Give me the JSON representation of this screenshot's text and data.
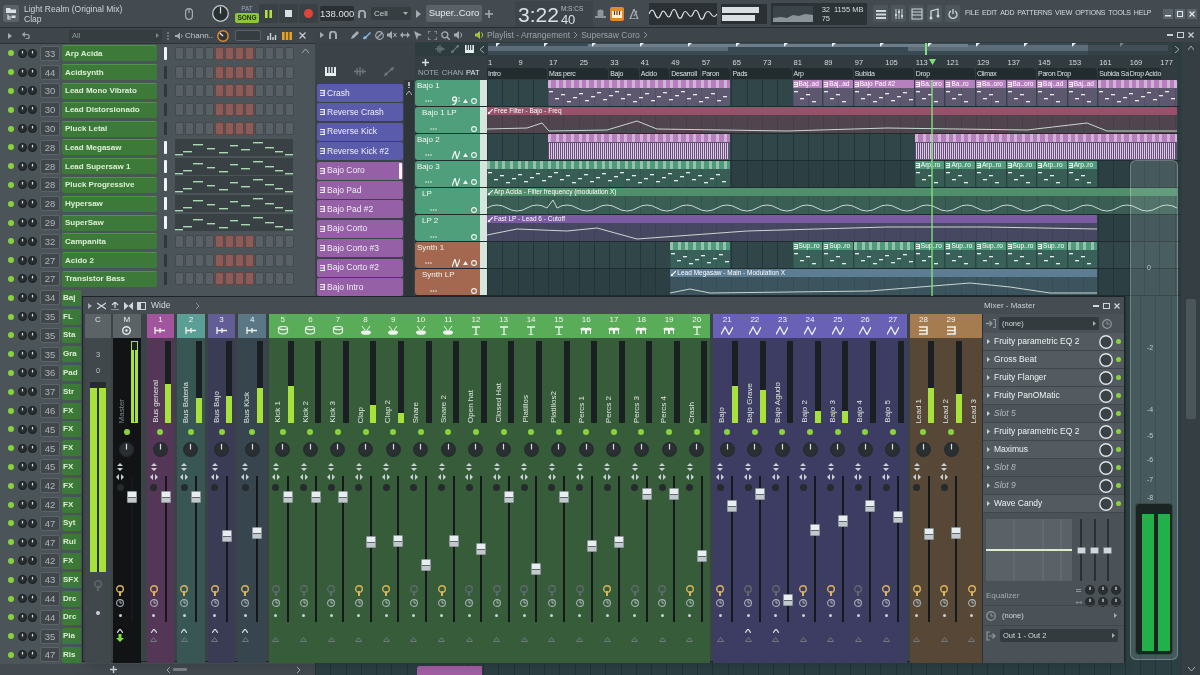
{
  "title_bar": {
    "song": "Light Realm (Original Mix)",
    "hint": "Clap"
  },
  "transport": {
    "modes": [
      {
        "label": "PAT",
        "selected": false
      },
      {
        "label": "SONG",
        "selected": true
      }
    ],
    "playing": true,
    "tempo": "138.000",
    "snap": "Cell",
    "pattern": "Super..Coro",
    "time": "3:22",
    "time_fraction": "40",
    "time_unit": "M:S:CS",
    "output_meter": {
      "level": 0.85
    },
    "cpu": "32",
    "memory": "1155 MB",
    "polyphony": "75"
  },
  "menu": [
    "FILE",
    "EDIT",
    "ADD",
    "PATTERNS",
    "VIEW",
    "OPTIONS",
    "TOOLS",
    "HELP"
  ],
  "channel_rack": {
    "filter": "All",
    "title": "Chann..",
    "channels": [
      {
        "kind": "steps",
        "number": "33",
        "name": "Arp Acida",
        "selected": true
      },
      {
        "kind": "steps",
        "number": "44",
        "name": "Acidsynth",
        "selected": false
      },
      {
        "kind": "steps",
        "number": "30",
        "name": "Lead Mono Vibrato",
        "selected": false
      },
      {
        "kind": "steps",
        "number": "30",
        "name": "Lead Distorsionado",
        "selected": false
      },
      {
        "kind": "steps",
        "number": "30",
        "name": "Pluck Letal",
        "selected": false
      },
      {
        "kind": "roll",
        "number": "28",
        "name": "Lead Megasaw",
        "selected": true
      },
      {
        "kind": "roll",
        "number": "28",
        "name": "Lead Supersaw 1",
        "selected": true
      },
      {
        "kind": "roll",
        "number": "28",
        "name": "Pluck Progressive",
        "selected": true
      },
      {
        "kind": "roll",
        "number": "28",
        "name": "Hypersaw",
        "selected": true
      },
      {
        "kind": "roll",
        "number": "29",
        "name": "SuperSaw",
        "selected": true
      },
      {
        "kind": "steps",
        "number": "32",
        "name": "Campanita",
        "selected": false
      },
      {
        "kind": "steps",
        "number": "27",
        "name": "Acido 2",
        "selected": false
      },
      {
        "kind": "steps",
        "number": "27",
        "name": "Transistor Bass",
        "selected": false
      },
      {
        "kind": "cut",
        "number": "34",
        "name": "Baj"
      },
      {
        "kind": "cut",
        "number": "35",
        "name": "FL"
      },
      {
        "kind": "cut",
        "number": "35",
        "name": "Sta"
      },
      {
        "kind": "cut",
        "number": "35",
        "name": "Gra"
      },
      {
        "kind": "cut",
        "number": "36",
        "name": "Pad"
      },
      {
        "kind": "cut",
        "number": "37",
        "name": "Str"
      },
      {
        "kind": "cut",
        "number": "46",
        "name": "FX"
      },
      {
        "kind": "cut",
        "number": "45",
        "name": "FX"
      },
      {
        "kind": "cut",
        "number": "45",
        "name": "FX"
      },
      {
        "kind": "cut",
        "number": "45",
        "name": "FX"
      },
      {
        "kind": "cut",
        "number": "42",
        "name": "FX"
      },
      {
        "kind": "cut",
        "number": "42",
        "name": "FX"
      },
      {
        "kind": "cut",
        "number": "47",
        "name": "Syt"
      },
      {
        "kind": "cut",
        "number": "47",
        "name": "Rui"
      },
      {
        "kind": "cut",
        "number": "42",
        "name": "FX"
      },
      {
        "kind": "cut",
        "number": "43",
        "name": "SFX"
      },
      {
        "kind": "cut",
        "number": "44",
        "name": "Drc"
      },
      {
        "kind": "cut",
        "number": "44",
        "name": "Drc"
      },
      {
        "kind": "cut",
        "number": "35",
        "name": "Pia"
      },
      {
        "kind": "cut",
        "number": "47",
        "name": "Ris"
      }
    ]
  },
  "playlist": {
    "title": "Playlist - Arrangement",
    "pattern": "Supersaw Coro",
    "header_labels": [
      "NOTE",
      "CHAN",
      "PAT"
    ],
    "picker": [
      {
        "name": "Crash",
        "color": "#5a5cab",
        "selected": false
      },
      {
        "name": "Reverse Crash",
        "color": "#5a5cab",
        "selected": false
      },
      {
        "name": "Reverse Kick",
        "color": "#5a5cab",
        "selected": false
      },
      {
        "name": "Reverse Kick #2",
        "color": "#5a5cab",
        "selected": false
      },
      {
        "name": "Bajo Coro",
        "color": "#9660a6",
        "selected": true
      },
      {
        "name": "Bajo Pad",
        "color": "#9660a6",
        "selected": false
      },
      {
        "name": "Bajo Pad #2",
        "color": "#9660a6",
        "selected": false
      },
      {
        "name": "Bajo Corto",
        "color": "#9660a6",
        "selected": false
      },
      {
        "name": "Bajo Corto #3",
        "color": "#9660a6",
        "selected": false
      },
      {
        "name": "Bajo Corto #2",
        "color": "#9660a6",
        "selected": false
      },
      {
        "name": "Bajo Intro",
        "color": "#9660a6",
        "selected": false
      }
    ],
    "bars": [
      "1",
      "9",
      "17",
      "25",
      "33",
      "41",
      "49",
      "57",
      "65",
      "73",
      "81",
      "89",
      "97",
      "105",
      "113",
      "121",
      "129",
      "137",
      "145",
      "153",
      "161",
      "169",
      "177"
    ],
    "markers": [
      "Intro",
      "Mas perc",
      "Bajo",
      "Acido",
      "Desarroll",
      "Paron",
      "Pads",
      "Arp",
      "Subida",
      "Drop",
      "Climax",
      "Paron Drop",
      "Subida Sa",
      "Drop Acido"
    ],
    "tracks": [
      {
        "name": "Bajo 1",
        "kind": "bass",
        "color": "#4f9e7c",
        "enabled": true,
        "clips": [
          "Baj..ad",
          "Baj..ad",
          "Bajo Pad #2",
          "Ba..oro",
          "Ba..ro",
          "Ba..oro",
          "Ba..oro",
          "Baj..ad",
          "Baj..ad"
        ]
      },
      {
        "name": "Bajo 1 LP",
        "kind": "automation",
        "color": "#4f9e7c",
        "enabled": true,
        "clips": [
          "Free Filter - Bajo - Freq"
        ]
      },
      {
        "name": "Bajo 2",
        "kind": "synth",
        "color": "#4f9e7c",
        "enabled": true
      },
      {
        "name": "Bajo 3",
        "kind": "synth",
        "color": "#4f9e7c",
        "enabled": true,
        "clips": [
          "Arp..ro",
          "Arp..ro",
          "Arp..ro",
          "Arp..ro",
          "Arp..ro",
          "Arp..ro"
        ]
      },
      {
        "name": "LP",
        "kind": "automation",
        "color": "#4f9e7c",
        "enabled": true,
        "clips": [
          "Arp Acida - Filter frequency (modulation X)"
        ]
      },
      {
        "name": "LP 2",
        "kind": "automation",
        "color": "#4f9e7c",
        "enabled": true,
        "clips": [
          "Fast LP - Lead 6 - Cutoff"
        ]
      },
      {
        "name": "Synth 1",
        "kind": "synth",
        "color": "#a3684f",
        "enabled": true,
        "clips": [
          "Sup..ro",
          "Sup..ro",
          "Sup..ro",
          "Sup..ro",
          "Sup..ro",
          "Sup..ro",
          "Sup..ro"
        ]
      },
      {
        "name": "Synth LP",
        "kind": "automation",
        "color": "#a3684f",
        "enabled": true,
        "clips": [
          "Lead Megasaw - Main - Modulation X"
        ]
      }
    ]
  },
  "mixer": {
    "preset": "Wide",
    "tracks": [
      {
        "kind": "current",
        "number": "C",
        "scale": [
          "3",
          "0"
        ],
        "meter": {
          "level": 0.97
        }
      },
      {
        "kind": "master",
        "number": "M",
        "name": "Master",
        "meter": {
          "level": 0.9
        },
        "fader": {
          "level": 0.89
        },
        "routed": true,
        "send": true
      },
      {
        "kind": "insert",
        "number": "1",
        "name": "Bus general",
        "color": "#a0559c",
        "meter": {
          "level": 0.48
        },
        "fader": {
          "level": 0.89
        },
        "routed": true,
        "send": true
      },
      {
        "kind": "insert",
        "number": "2",
        "name": "Bus Bateria",
        "color": "#5b9e95",
        "meter": {
          "level": 0.3
        },
        "fader": {
          "level": 0.89
        },
        "routed": true,
        "send": true
      },
      {
        "kind": "insert",
        "number": "3",
        "name": "Bus Bajo",
        "color": "#625d94",
        "meter": {
          "level": 0.33
        },
        "fader": {
          "level": 0.6
        },
        "routed": true,
        "send": true
      },
      {
        "kind": "insert",
        "number": "4",
        "name": "Bus Kick",
        "color": "#5b7786",
        "meter": {
          "level": 0.43
        },
        "fader": {
          "level": 0.62
        },
        "routed": true,
        "send": true
      },
      {
        "kind": "insert",
        "number": "5",
        "name": "Kick 1",
        "color": "#5aad58",
        "meter": {
          "level": 0.45
        },
        "fader": {
          "level": 0.89
        },
        "routed": false,
        "send": false
      },
      {
        "kind": "insert",
        "number": "6",
        "name": "Kick 2",
        "color": "#5aad58",
        "fader": {
          "level": 0.89
        },
        "routed": false,
        "send": false
      },
      {
        "kind": "insert",
        "number": "7",
        "name": "Kick 3",
        "color": "#5aad58",
        "fader": {
          "level": 0.89
        },
        "routed": false,
        "send": false
      },
      {
        "kind": "insert",
        "number": "8",
        "name": "Clap",
        "color": "#5aad58",
        "meter": {
          "level": 0.22
        },
        "fader": {
          "level": 0.55
        },
        "routed": true,
        "send": false
      },
      {
        "kind": "insert",
        "number": "9",
        "name": "Clap 2",
        "color": "#5aad58",
        "meter": {
          "level": 0.12
        },
        "fader": {
          "level": 0.56
        },
        "routed": true,
        "send": false
      },
      {
        "kind": "insert",
        "number": "10",
        "name": "Snare",
        "color": "#5aad58",
        "fader": {
          "level": 0.38
        },
        "routed": false,
        "send": false
      },
      {
        "kind": "insert",
        "number": "11",
        "name": "Snare 2",
        "color": "#5aad58",
        "fader": {
          "level": 0.56
        },
        "routed": true,
        "send": false
      },
      {
        "kind": "insert",
        "number": "12",
        "name": "Open hat",
        "color": "#5aad58",
        "fader": {
          "level": 0.5
        },
        "routed": false,
        "send": false
      },
      {
        "kind": "insert",
        "number": "13",
        "name": "Closed Hat",
        "color": "#5aad58",
        "fader": {
          "level": 0.89
        },
        "routed": false,
        "send": false
      },
      {
        "kind": "insert",
        "number": "14",
        "name": "Platillos",
        "color": "#5aad58",
        "fader": {
          "level": 0.35
        },
        "routed": false,
        "send": false
      },
      {
        "kind": "insert",
        "number": "15",
        "name": "Platillos2",
        "color": "#5aad58",
        "fader": {
          "level": 0.89
        },
        "routed": false,
        "send": false
      },
      {
        "kind": "insert",
        "number": "16",
        "name": "Percs 1",
        "color": "#5aad58",
        "fader": {
          "level": 0.52
        },
        "routed": false,
        "send": false
      },
      {
        "kind": "insert",
        "number": "17",
        "name": "Percs 2",
        "color": "#5aad58",
        "fader": {
          "level": 0.55
        },
        "routed": true,
        "send": false
      },
      {
        "kind": "insert",
        "number": "18",
        "name": "Percs 3",
        "color": "#5aad58",
        "fader": {
          "level": 0.91
        },
        "routed": false,
        "send": false
      },
      {
        "kind": "insert",
        "number": "19",
        "name": "Percs 4",
        "color": "#5aad58",
        "fader": {
          "level": 0.91
        },
        "routed": false,
        "send": false
      },
      {
        "kind": "insert",
        "number": "20",
        "name": "Crash",
        "color": "#5aad58",
        "fader": {
          "level": 0.45
        },
        "routed": true,
        "send": false
      },
      {
        "kind": "insert",
        "number": "21",
        "name": "Bajo",
        "color": "#6861b6",
        "meter": {
          "level": 0.45
        },
        "fader": {
          "level": 0.82
        },
        "routed": true,
        "send": false
      },
      {
        "kind": "insert",
        "number": "22",
        "name": "Bajo Grave",
        "color": "#6861b6",
        "meter": {
          "level": 0.4
        },
        "fader": {
          "level": 0.91
        },
        "routed": false,
        "send": true
      },
      {
        "kind": "insert",
        "number": "23",
        "name": "Bajo Agudo",
        "color": "#6861b6",
        "fader": {
          "level": 0.12
        },
        "routed": false,
        "send": true
      },
      {
        "kind": "insert",
        "number": "24",
        "name": "Bajo 2",
        "color": "#6861b6",
        "meter": {
          "level": 0.15
        },
        "fader": {
          "level": 0.64
        },
        "routed": true,
        "send": false
      },
      {
        "kind": "insert",
        "number": "25",
        "name": "Bajo 3",
        "color": "#6861b6",
        "meter": {
          "level": 0.15
        },
        "fader": {
          "level": 0.71
        },
        "routed": true,
        "send": false
      },
      {
        "kind": "insert",
        "number": "26",
        "name": "Bajo 4",
        "color": "#6861b6",
        "fader": {
          "level": 0.82
        },
        "routed": false,
        "send": false
      },
      {
        "kind": "insert",
        "number": "27",
        "name": "Bajo 5",
        "color": "#6861b6",
        "fader": {
          "level": 0.74
        },
        "routed": true,
        "send": false
      },
      {
        "kind": "insert",
        "number": "28",
        "name": "Lead 1",
        "color": "#a57b50",
        "meter": {
          "level": 0.43
        },
        "fader": {
          "level": 0.61
        },
        "routed": true,
        "send": false
      },
      {
        "kind": "insert",
        "number": "29",
        "name": "Lead 2",
        "color": "#a57b50",
        "meter": {
          "level": 0.35
        },
        "fader": {
          "level": 0.62
        },
        "routed": true,
        "send": false
      },
      {
        "kind": "partial",
        "name": "Lead 3",
        "color": "#a57b50",
        "routed": true
      }
    ],
    "insert": {
      "title": "Mixer - Master",
      "input": "(none)",
      "slots": [
        {
          "name": "Fruity parametric EQ 2",
          "empty": false
        },
        {
          "name": "Gross Beat",
          "empty": false
        },
        {
          "name": "Fruity Flanger",
          "empty": false
        },
        {
          "name": "Fruity PanOMatic",
          "empty": false
        },
        {
          "name": "Slot 5",
          "empty": true
        },
        {
          "name": "Fruity parametric EQ 2",
          "empty": false
        },
        {
          "name": "Maximus",
          "empty": false
        },
        {
          "name": "Slot 8",
          "empty": true
        },
        {
          "name": "Slot 9",
          "empty": true
        },
        {
          "name": "Wave Candy",
          "empty": false
        }
      ],
      "equalizer": {
        "label": "Equalizer",
        "bands": [
          {
            "level": 0.5
          },
          {
            "level": 0.5
          },
          {
            "level": 0.5
          }
        ]
      },
      "sidechain": "(none)",
      "output": "Out 1 - Out 2"
    }
  },
  "peak_meter": {
    "scale": [
      "0",
      "-2",
      "-4",
      "-5",
      "-6",
      "-7",
      "-8"
    ],
    "level": 0.95
  }
}
